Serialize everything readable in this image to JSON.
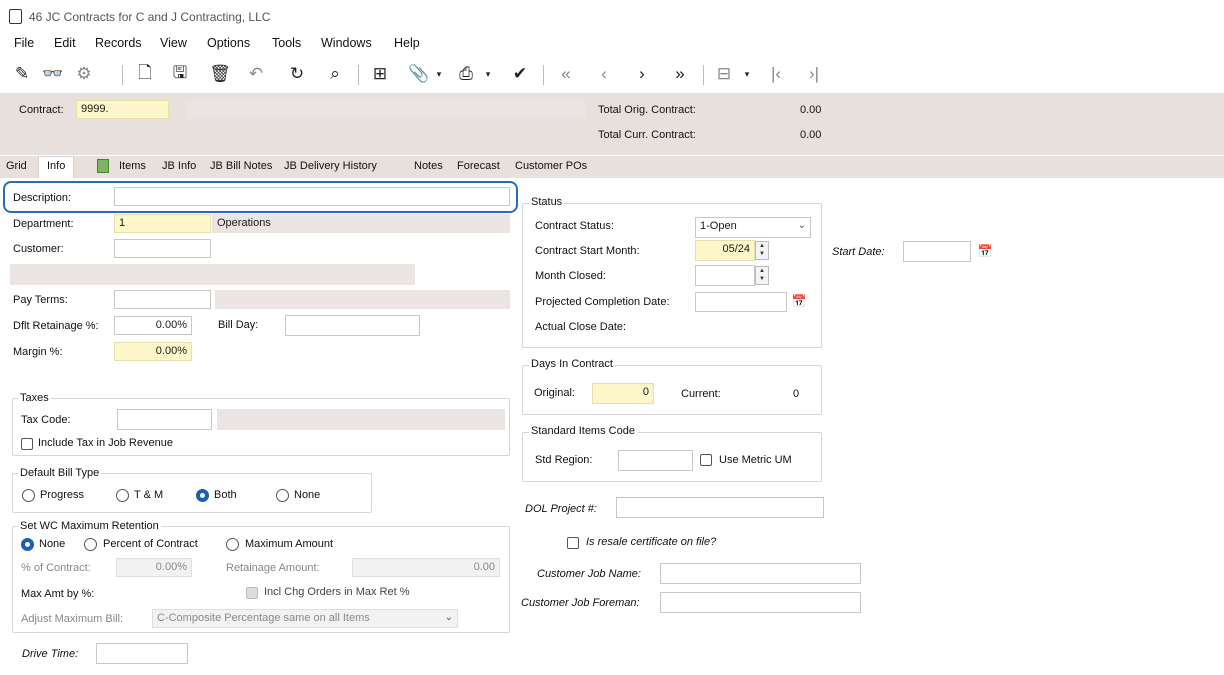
{
  "window": {
    "title": "46 JC Contracts for C and J Contracting, LLC"
  },
  "menu": [
    "File",
    "Edit",
    "Records",
    "View",
    "Options",
    "Tools",
    "Windows",
    "Help"
  ],
  "toolbar": {
    "icons": [
      "edit-icon",
      "find-icon",
      "clear-icon",
      "new-icon",
      "save-icon",
      "delete-icon",
      "undo-icon",
      "refresh-icon",
      "search-icon",
      "grid-icon",
      "attach-icon",
      "print-icon",
      "spellcheck-icon",
      "first-icon",
      "prev-icon",
      "next-icon",
      "last-icon",
      "view-icon",
      "start-icon",
      "end-icon"
    ]
  },
  "header": {
    "contract_label": "Contract:",
    "contract_value": "9999.",
    "contract_desc": "",
    "total_orig_label": "Total Orig. Contract:",
    "total_orig_value": "0.00",
    "total_curr_label": "Total Curr. Contract:",
    "total_curr_value": "0.00"
  },
  "tabs": [
    "Grid",
    "Info",
    "Items",
    "JB Info",
    "JB Bill Notes",
    "JB Delivery History",
    "Notes",
    "Forecast",
    "Customer POs"
  ],
  "form": {
    "description_label": "Description:",
    "description_value": "",
    "department_label": "Department:",
    "department_value": "1",
    "department_name": "Operations",
    "customer_label": "Customer:",
    "customer_value": "",
    "pay_terms_label": "Pay Terms:",
    "dflt_retainage_label": "Dflt Retainage %:",
    "dflt_retainage_value": "0.00%",
    "bill_day_label": "Bill Day:",
    "margin_label": "Margin %:",
    "margin_value": "0.00%"
  },
  "taxes": {
    "title": "Taxes",
    "tax_code_label": "Tax Code:",
    "include_tax_label": "Include Tax in Job Revenue"
  },
  "bill_type": {
    "title": "Default Bill Type",
    "options": [
      "Progress",
      "T & M",
      "Both",
      "None"
    ],
    "selected": "Both"
  },
  "wc_retention": {
    "title": "Set WC Maximum Retention",
    "options": [
      "None",
      "Percent of Contract",
      "Maximum Amount"
    ],
    "selected": "None",
    "pct_contract_label": "% of Contract:",
    "pct_contract_value": "0.00%",
    "retainage_amount_label": "Retainage Amount:",
    "retainage_amount_value": "0.00",
    "max_amt_label": "Max Amt by %:",
    "incl_chg_orders_label": "Incl Chg Orders in Max Ret %",
    "adjust_max_bill_label": "Adjust Maximum Bill:",
    "adjust_max_bill_value": "C-Composite Percentage same on all Items"
  },
  "drive_time_label": "Drive Time:",
  "status": {
    "title": "Status",
    "contract_status_label": "Contract Status:",
    "contract_status_value": "1-Open",
    "start_month_label": "Contract Start Month:",
    "start_month_value": "05/24",
    "month_closed_label": "Month Closed:",
    "projected_completion_label": "Projected Completion Date:",
    "actual_close_label": "Actual Close Date:"
  },
  "start_date_label": "Start Date:",
  "days": {
    "title": "Days In Contract",
    "original_label": "Original:",
    "original_value": "0",
    "current_label": "Current:",
    "current_value": "0"
  },
  "std_items": {
    "title": "Standard Items Code",
    "std_region_label": "Std Region:",
    "use_metric_label": "Use Metric UM"
  },
  "dol_project_label": "DOL Project #:",
  "resale_cert_label": "Is resale certificate on file?",
  "customer_job_name_label": "Customer Job Name:",
  "customer_job_foreman_label": "Customer Job Foreman:"
}
